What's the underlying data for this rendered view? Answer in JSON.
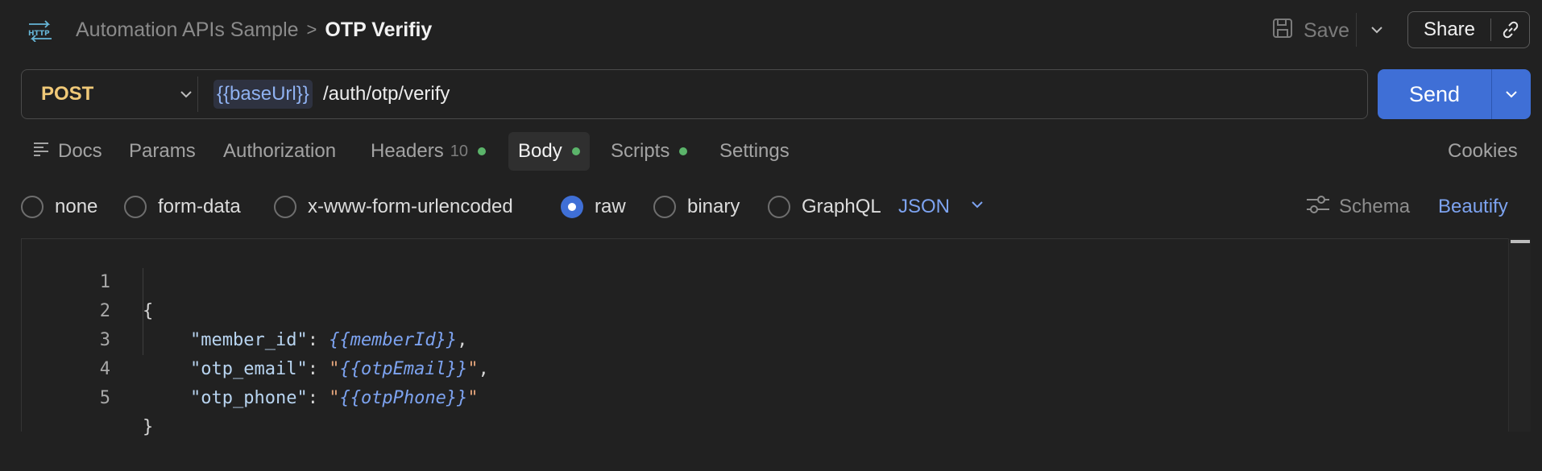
{
  "header": {
    "protocol_icon": "http-icon",
    "breadcrumb_parent": "Automation APIs Sample",
    "breadcrumb_separator": ">",
    "breadcrumb_current": "OTP Verifiy",
    "save_label": "Save",
    "share_label": "Share"
  },
  "request": {
    "method": "POST",
    "url_variable": "{{baseUrl}}",
    "url_path": "/auth/otp/verify",
    "send_label": "Send"
  },
  "tabs": [
    {
      "label": "Docs"
    },
    {
      "label": "Params"
    },
    {
      "label": "Authorization"
    },
    {
      "label": "Headers",
      "count": "10",
      "dot": true
    },
    {
      "label": "Body",
      "active": true,
      "dot": true
    },
    {
      "label": "Scripts",
      "dot": true
    },
    {
      "label": "Settings"
    }
  ],
  "cookies_label": "Cookies",
  "body_modes": [
    {
      "label": "none",
      "checked": false
    },
    {
      "label": "form-data",
      "checked": false
    },
    {
      "label": "x-www-form-urlencoded",
      "checked": false
    },
    {
      "label": "raw",
      "checked": true
    },
    {
      "label": "binary",
      "checked": false
    },
    {
      "label": "GraphQL",
      "checked": false
    }
  ],
  "raw_format": "JSON",
  "schema_label": "Schema",
  "beautify_label": "Beautify",
  "editor": {
    "line_numbers": [
      "1",
      "2",
      "3",
      "4",
      "5"
    ],
    "open_brace": "{",
    "close_brace": "}",
    "entries": [
      {
        "key": "\"member_id\"",
        "colon": ": ",
        "quote_open": "",
        "value": "{{memberId}}",
        "quote_close": "",
        "trail": ","
      },
      {
        "key": "\"otp_email\"",
        "colon": ": ",
        "quote_open": "\"",
        "value": "{{otpEmail}}",
        "quote_close": "\"",
        "trail": ","
      },
      {
        "key": "\"otp_phone\"",
        "colon": ": ",
        "quote_open": "\"",
        "value": "{{otpPhone}}",
        "quote_close": "\"",
        "trail": ""
      }
    ]
  },
  "colors": {
    "background": "#212121",
    "accent_blue": "#3f6fd6",
    "method_yellow": "#f0c978",
    "status_dot_green": "#5bb46a",
    "variable_blue": "#7da3f0",
    "string_orange": "#e2a37a"
  }
}
